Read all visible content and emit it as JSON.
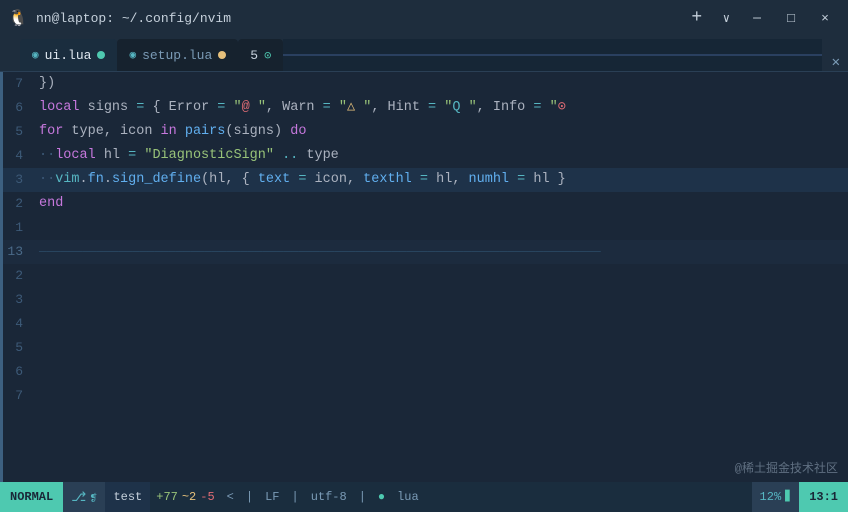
{
  "titlebar": {
    "icon": "🐧",
    "title": "nn@laptop: ~/.config/nvim",
    "close_label": "×",
    "min_label": "─",
    "max_label": "□",
    "new_tab_label": "+",
    "tab_arrow_label": "∨"
  },
  "tabs": [
    {
      "name": "ui.lua",
      "active": true,
      "dot_color": "green",
      "close": ""
    },
    {
      "name": "setup.lua",
      "active": false,
      "dot_color": "orange",
      "close": ""
    },
    {
      "number": "5",
      "arrow": "→"
    }
  ],
  "lines": [
    {
      "num": "7",
      "content": "})",
      "tokens": [
        {
          "t": "punct",
          "v": "})"
        }
      ]
    },
    {
      "num": "6",
      "content": "local signs = { Error = \"@ \", Warn = \"△ \", Hint = \"Q \", Info = \"①",
      "tokens": []
    },
    {
      "num": "5",
      "content": "for type, icon in pairs(signs) do",
      "tokens": []
    },
    {
      "num": "4",
      "content": "  local hl = \"DiagnosticSign\" .. type",
      "tokens": []
    },
    {
      "num": "3",
      "content": "  vim.fn.sign_define(hl, { text = icon, texthl = hl, numhl = hl }",
      "tokens": []
    },
    {
      "num": "2",
      "content": "end",
      "tokens": []
    },
    {
      "num": "1",
      "content": "",
      "tokens": []
    },
    {
      "num": "13",
      "content": "",
      "tokens": [],
      "ghost": true
    },
    {
      "num": "2",
      "content": "",
      "tokens": []
    },
    {
      "num": "3",
      "content": "",
      "tokens": []
    },
    {
      "num": "4",
      "content": "",
      "tokens": []
    },
    {
      "num": "5",
      "content": "",
      "tokens": []
    },
    {
      "num": "6",
      "content": "",
      "tokens": []
    },
    {
      "num": "7",
      "content": "",
      "tokens": []
    }
  ],
  "statusbar": {
    "mode": "NORMAL",
    "git_icon": "⎇",
    "branch": "test",
    "diff_add": "+77",
    "diff_change": "~2",
    "diff_del": "-5",
    "sep1": "<",
    "sep2": "|",
    "lf": "LF",
    "sep3": "|",
    "encoding": "utf-8",
    "sep4": "|",
    "lua_icon": "●",
    "filetype": "lua",
    "percent": "12%",
    "position": "13:1"
  },
  "watermark": "@稀土掘金技术社区"
}
